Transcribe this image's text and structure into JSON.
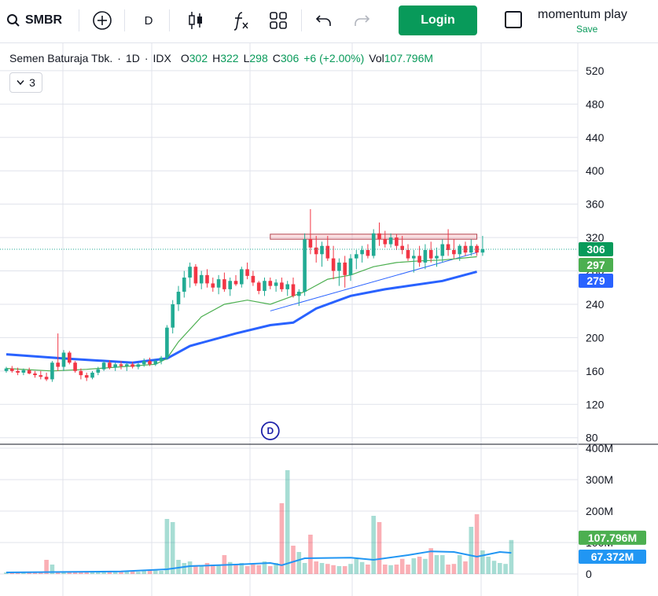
{
  "toolbar": {
    "symbol": "SMBR",
    "interval": "D",
    "login_label": "Login",
    "layout_name": "momentum play",
    "layout_save": "Save"
  },
  "legend": {
    "name": "Semen Baturaja Tbk.",
    "interval": "1D",
    "exchange": "IDX",
    "o_label": "O",
    "o": "302",
    "h_label": "H",
    "h": "322",
    "l_label": "L",
    "l": "298",
    "c_label": "C",
    "c": "306",
    "change": "+6 (+2.00%)",
    "vol_label": "Vol",
    "vol": "107.796M",
    "indicators_count": "3"
  },
  "colors": {
    "up": "#22ab94",
    "down": "#f23645",
    "ma_fast": "#4caf50",
    "ma_slow": "#2962ff",
    "vol_ma": "#2196f3",
    "accent": "#089a5a"
  },
  "chart_data": [
    {
      "type": "candlestick",
      "title": "Semen Baturaja Tbk. · 1D · IDX",
      "ylim": [
        75,
        535
      ],
      "yticks": [
        "520",
        "480",
        "440",
        "400",
        "360",
        "320",
        "280",
        "240",
        "200",
        "160",
        "120",
        "80"
      ],
      "price_labels": [
        {
          "value": 306,
          "text": "306",
          "color": "#089a5a"
        },
        {
          "value": 297,
          "text": "297",
          "color": "#4caf50"
        },
        {
          "value": 279,
          "text": "279",
          "color": "#2962ff"
        }
      ],
      "resistance_zone": {
        "from": 318,
        "to": 324,
        "start_index": 46,
        "end_index": 82
      },
      "trendline": {
        "start_index": 46,
        "start": 232,
        "end_index": 82,
        "end": 302
      },
      "event_marker": {
        "index": 46,
        "text": "D"
      },
      "ohlc": [
        [
          160,
          165,
          158,
          163
        ],
        [
          163,
          166,
          158,
          160
        ],
        [
          160,
          164,
          155,
          158
        ],
        [
          158,
          163,
          155,
          161
        ],
        [
          161,
          164,
          156,
          157
        ],
        [
          157,
          160,
          152,
          155
        ],
        [
          155,
          160,
          150,
          153
        ],
        [
          153,
          158,
          148,
          150
        ],
        [
          150,
          172,
          147,
          170
        ],
        [
          170,
          205,
          160,
          165
        ],
        [
          165,
          185,
          160,
          182
        ],
        [
          182,
          184,
          168,
          170
        ],
        [
          170,
          172,
          158,
          160
        ],
        [
          160,
          163,
          150,
          155
        ],
        [
          155,
          158,
          148,
          152
        ],
        [
          152,
          160,
          150,
          158
        ],
        [
          158,
          165,
          155,
          162
        ],
        [
          162,
          172,
          160,
          170
        ],
        [
          170,
          173,
          162,
          164
        ],
        [
          164,
          170,
          160,
          168
        ],
        [
          168,
          172,
          162,
          166
        ],
        [
          166,
          170,
          160,
          168
        ],
        [
          168,
          171,
          163,
          165
        ],
        [
          165,
          170,
          162,
          168
        ],
        [
          168,
          175,
          165,
          172
        ],
        [
          172,
          176,
          166,
          168
        ],
        [
          168,
          174,
          166,
          172
        ],
        [
          172,
          178,
          168,
          176
        ],
        [
          176,
          215,
          174,
          212
        ],
        [
          212,
          245,
          205,
          240
        ],
        [
          240,
          262,
          232,
          255
        ],
        [
          255,
          280,
          248,
          272
        ],
        [
          272,
          290,
          260,
          285
        ],
        [
          285,
          288,
          262,
          265
        ],
        [
          265,
          280,
          258,
          275
        ],
        [
          275,
          282,
          260,
          265
        ],
        [
          265,
          272,
          255,
          260
        ],
        [
          260,
          275,
          252,
          270
        ],
        [
          270,
          278,
          255,
          258
        ],
        [
          258,
          272,
          250,
          268
        ],
        [
          268,
          275,
          262,
          264
        ],
        [
          264,
          285,
          260,
          282
        ],
        [
          282,
          290,
          270,
          274
        ],
        [
          274,
          280,
          262,
          266
        ],
        [
          266,
          268,
          252,
          256
        ],
        [
          256,
          272,
          250,
          268
        ],
        [
          268,
          272,
          258,
          262
        ],
        [
          262,
          270,
          255,
          266
        ],
        [
          266,
          272,
          255,
          258
        ],
        [
          258,
          268,
          250,
          264
        ],
        [
          264,
          272,
          248,
          250
        ],
        [
          250,
          258,
          238,
          255
        ],
        [
          255,
          325,
          250,
          318
        ],
        [
          318,
          354,
          300,
          308
        ],
        [
          308,
          322,
          290,
          300
        ],
        [
          300,
          315,
          285,
          310
        ],
        [
          310,
          322,
          292,
          295
        ],
        [
          295,
          310,
          270,
          280
        ],
        [
          280,
          295,
          262,
          290
        ],
        [
          290,
          298,
          260,
          275
        ],
        [
          275,
          300,
          268,
          295
        ],
        [
          295,
          305,
          282,
          300
        ],
        [
          300,
          310,
          290,
          305
        ],
        [
          305,
          312,
          295,
          298
        ],
        [
          298,
          330,
          295,
          325
        ],
        [
          325,
          338,
          310,
          318
        ],
        [
          318,
          328,
          308,
          312
        ],
        [
          312,
          325,
          308,
          320
        ],
        [
          320,
          324,
          305,
          310
        ],
        [
          310,
          322,
          300,
          305
        ],
        [
          305,
          312,
          292,
          295
        ],
        [
          295,
          305,
          278,
          298
        ],
        [
          298,
          310,
          285,
          290
        ],
        [
          290,
          312,
          282,
          305
        ],
        [
          305,
          315,
          290,
          295
        ],
        [
          295,
          308,
          285,
          298
        ],
        [
          298,
          318,
          290,
          312
        ],
        [
          312,
          330,
          298,
          305
        ],
        [
          305,
          318,
          295,
          300
        ],
        [
          300,
          312,
          292,
          310
        ],
        [
          310,
          315,
          298,
          302
        ],
        [
          302,
          318,
          298,
          310
        ],
        [
          310,
          312,
          298,
          302
        ],
        [
          302,
          322,
          298,
          306
        ]
      ],
      "ma_fast": [
        [
          0,
          163
        ],
        [
          8,
          160
        ],
        [
          14,
          162
        ],
        [
          20,
          165
        ],
        [
          26,
          168
        ],
        [
          28,
          175
        ],
        [
          30,
          195
        ],
        [
          34,
          225
        ],
        [
          38,
          240
        ],
        [
          42,
          245
        ],
        [
          46,
          240
        ],
        [
          52,
          255
        ],
        [
          56,
          270
        ],
        [
          60,
          275
        ],
        [
          64,
          285
        ],
        [
          68,
          290
        ],
        [
          72,
          292
        ],
        [
          76,
          293
        ],
        [
          82,
          297
        ]
      ],
      "ma_slow": [
        [
          0,
          180
        ],
        [
          10,
          175
        ],
        [
          22,
          170
        ],
        [
          28,
          175
        ],
        [
          32,
          190
        ],
        [
          40,
          205
        ],
        [
          46,
          215
        ],
        [
          50,
          218
        ],
        [
          54,
          235
        ],
        [
          60,
          250
        ],
        [
          66,
          258
        ],
        [
          70,
          262
        ],
        [
          76,
          268
        ],
        [
          82,
          279
        ]
      ]
    },
    {
      "type": "bar",
      "title": "Volume",
      "ylim": [
        0,
        400
      ],
      "yticks": [
        "400M",
        "300M",
        "200M",
        "100M",
        "0"
      ],
      "ma_label": {
        "text": "67.372M",
        "value": 67.372
      },
      "vol_label": {
        "text": "107.796M",
        "value": 107.796
      },
      "values": [
        5,
        6,
        4,
        5,
        7,
        5,
        5,
        45,
        30,
        8,
        6,
        8,
        7,
        5,
        6,
        9,
        6,
        8,
        10,
        7,
        6,
        9,
        8,
        7,
        10,
        12,
        11,
        10,
        175,
        165,
        45,
        35,
        40,
        28,
        25,
        35,
        30,
        30,
        60,
        38,
        30,
        35,
        25,
        30,
        28,
        40,
        25,
        35,
        225,
        330,
        90,
        70,
        35,
        125,
        40,
        35,
        32,
        28,
        25,
        25,
        32,
        48,
        38,
        30,
        185,
        165,
        30,
        28,
        30,
        48,
        30,
        50,
        55,
        48,
        82,
        60,
        60,
        30,
        32,
        60,
        40,
        150,
        190,
        75,
        55,
        42,
        35,
        32,
        108
      ],
      "vol_ma": [
        [
          0,
          5
        ],
        [
          20,
          8
        ],
        [
          28,
          15
        ],
        [
          32,
          25
        ],
        [
          40,
          30
        ],
        [
          46,
          35
        ],
        [
          48,
          28
        ],
        [
          52,
          50
        ],
        [
          60,
          52
        ],
        [
          64,
          45
        ],
        [
          70,
          60
        ],
        [
          74,
          72
        ],
        [
          78,
          70
        ],
        [
          82,
          55
        ],
        [
          86,
          70
        ],
        [
          88,
          67.372
        ]
      ]
    }
  ]
}
